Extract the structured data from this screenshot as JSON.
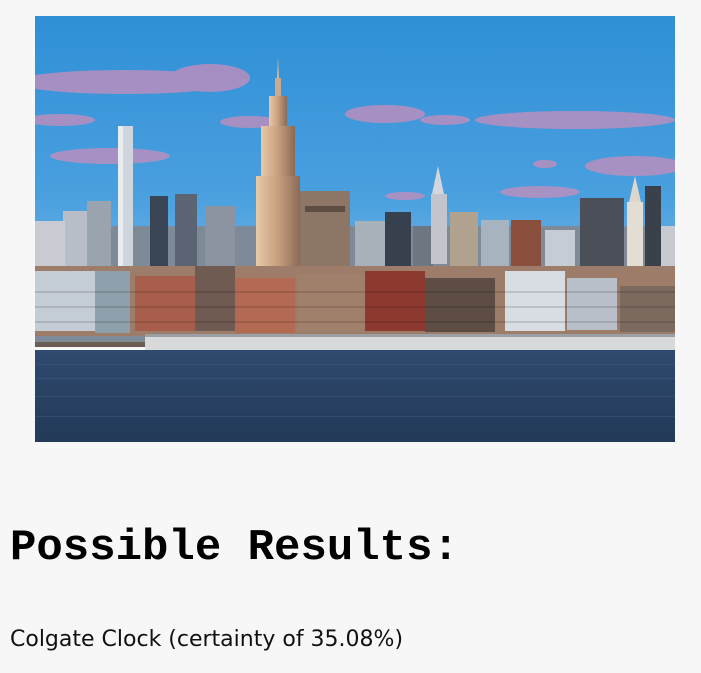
{
  "heading": "Possible Results:",
  "results": [
    {
      "text": "Colgate Clock (certainty of 35.08%)"
    }
  ]
}
